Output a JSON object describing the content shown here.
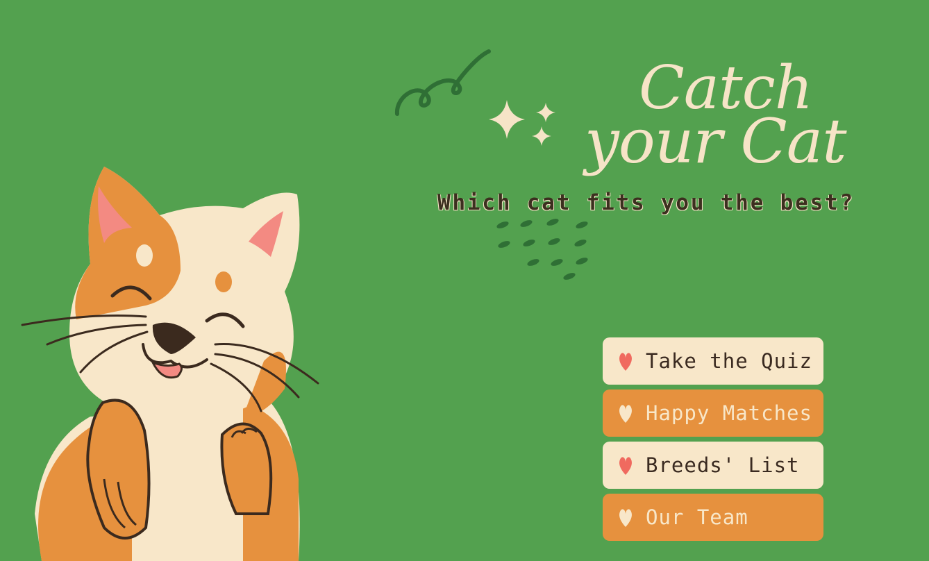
{
  "app": {
    "title_line1": "Catch",
    "title_line2": "your Cat",
    "subtitle": "Which cat fits you the best?"
  },
  "menu": {
    "items": [
      {
        "label": "Take the Quiz",
        "style": "light"
      },
      {
        "label": "Happy Matches",
        "style": "dark"
      },
      {
        "label": "Breeds' List",
        "style": "light"
      },
      {
        "label": "Our Team",
        "style": "dark"
      }
    ]
  },
  "colors": {
    "background": "#53a14f",
    "cream": "#f8e7c9",
    "orange": "#e6913e",
    "heart_pink": "#f06a5f",
    "text_dark": "#3a2a20"
  },
  "icons": {
    "swirl": "swirl-decoration-icon",
    "sparkle": "sparkle-icon",
    "dots": "dots-decoration-icon",
    "heart": "heart-icon",
    "cat": "cat-illustration-icon"
  }
}
